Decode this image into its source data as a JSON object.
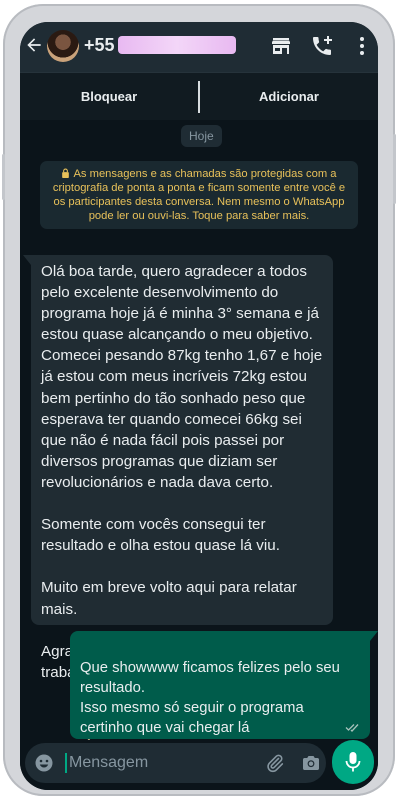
{
  "header": {
    "contact_name": "+55",
    "icons": [
      "back-arrow-icon",
      "avatar",
      "store-icon",
      "add-call-icon",
      "more-vert-icon"
    ]
  },
  "actions": {
    "block_label": "Bloquear",
    "add_label": "Adicionar"
  },
  "chat": {
    "date_chip": "Hoje",
    "encryption_notice": "As mensagens e as chamadas são protegidas com a criptografia de ponta a ponta e ficam somente entre você e os participantes desta conversa. Nem mesmo o WhatsApp pode ler ou ouvi-las. Toque para saber mais.",
    "incoming_message": "Olá boa tarde, quero agradecer a todos pelo excelente desenvolvimento do programa hoje já é minha 3° semana e já estou quase alcançando o meu objetivo. Comecei pesando 87kg tenho 1,67 e hoje já estou com meus incríveis 72kg estou bem pertinho do tão sonhado peso que esperava ter quando comecei 66kg sei que não é nada fácil pois passei por diversos programas que diziam ser revolucionários e nada dava certo.\n\nSomente com vocês consegui ter resultado e olha estou quase lá viu.\n\nMuito em breve volto aqui para relatar mais.\n\nAgradeço a todos pelo excelente trabalho. Até mais...",
    "outgoing_message": "Que showwww ficamos felizes pelo seu resultado.\nIsso mesmo só seguir o programa certinho que vai chegar lá"
  },
  "composer": {
    "placeholder": "Mensagem"
  },
  "colors": {
    "header_bg": "#1f2c34",
    "chat_bg": "#0b141a",
    "incoming_bubble": "#202c33",
    "outgoing_bubble": "#005c4b",
    "accent": "#00a884",
    "notice_text": "#e8c15a"
  }
}
